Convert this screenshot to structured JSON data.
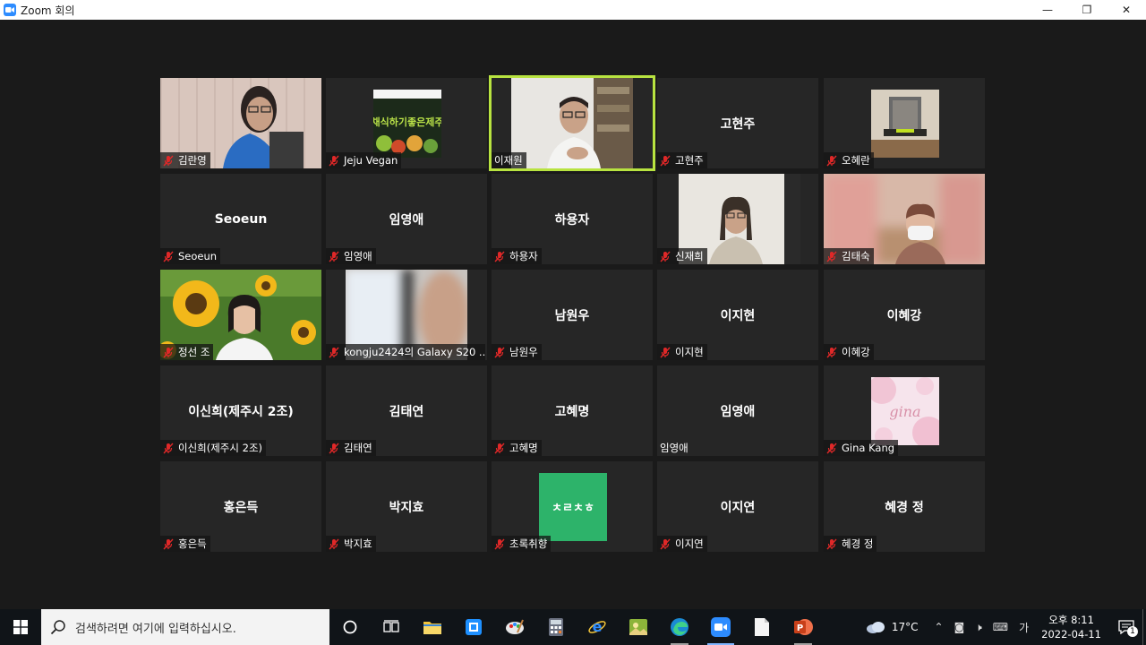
{
  "window": {
    "title": "Zoom 회의",
    "controls": {
      "minimize": "—",
      "maximize": "❐",
      "close": "✕"
    }
  },
  "tiles": [
    {
      "id": "kim-ranyoung",
      "label": "김란영",
      "center_name": "",
      "muted": true,
      "video": true
    },
    {
      "id": "jeju-vegan",
      "label": "Jeju Vegan",
      "center_name": "",
      "muted": true,
      "video": true,
      "video_text": "채식하기좋은제주"
    },
    {
      "id": "lee-jaewon",
      "label": "이재원",
      "center_name": "",
      "muted": false,
      "video": true,
      "active_speaker": true
    },
    {
      "id": "go-hyunjoo",
      "label": "고현주",
      "center_name": "고현주",
      "muted": true,
      "video": false
    },
    {
      "id": "oh-hyeran",
      "label": "오혜란",
      "center_name": "",
      "muted": true,
      "video": true
    },
    {
      "id": "seoeun",
      "label": "Seoeun",
      "center_name": "Seoeun",
      "muted": true,
      "video": false
    },
    {
      "id": "lim-youngae-1",
      "label": "임영애",
      "center_name": "임영애",
      "muted": true,
      "video": false
    },
    {
      "id": "ha-yongja",
      "label": "하용자",
      "center_name": "하용자",
      "muted": true,
      "video": false
    },
    {
      "id": "shin-jaehee",
      "label": "신재희",
      "center_name": "",
      "muted": true,
      "video": true
    },
    {
      "id": "kim-taesook",
      "label": "김태숙",
      "center_name": "",
      "muted": true,
      "video": true
    },
    {
      "id": "jo-jungsun",
      "label": "정선 조",
      "center_name": "",
      "muted": true,
      "video": true
    },
    {
      "id": "kongju2424",
      "label": "kongju2424의 Galaxy S20 ...",
      "center_name": "",
      "muted": true,
      "video": true
    },
    {
      "id": "nam-wonwoo",
      "label": "남원우",
      "center_name": "남원우",
      "muted": true,
      "video": false
    },
    {
      "id": "lee-jihyun",
      "label": "이지현",
      "center_name": "이지현",
      "muted": true,
      "video": false
    },
    {
      "id": "lee-hyekang",
      "label": "이혜강",
      "center_name": "이혜강",
      "muted": true,
      "video": false
    },
    {
      "id": "lee-shinhee",
      "label": "이신희(제주시 2조)",
      "center_name": "이신희(제주시 2조)",
      "muted": true,
      "video": false
    },
    {
      "id": "kim-taeyeon",
      "label": "김태연",
      "center_name": "김태연",
      "muted": true,
      "video": false
    },
    {
      "id": "go-hyemyung",
      "label": "고혜명",
      "center_name": "고혜명",
      "muted": true,
      "video": false
    },
    {
      "id": "lim-youngae-2",
      "label": "임영애",
      "center_name": "임영애",
      "muted": false,
      "video": false
    },
    {
      "id": "gina-kang",
      "label": "Gina Kang",
      "center_name": "",
      "muted": true,
      "video": true,
      "video_text": "gina"
    },
    {
      "id": "hong-eundeuk",
      "label": "홍은득",
      "center_name": "홍은득",
      "muted": true,
      "video": false
    },
    {
      "id": "park-jihyo",
      "label": "박지효",
      "center_name": "박지효",
      "muted": true,
      "video": false
    },
    {
      "id": "chorok-chwihyang",
      "label": "초록취향",
      "center_name": "",
      "muted": true,
      "video": true,
      "video_text": "ㅊㄹㅊㅎ"
    },
    {
      "id": "lee-jiyeon",
      "label": "이지연",
      "center_name": "이지연",
      "muted": true,
      "video": false
    },
    {
      "id": "hyekyung-jung",
      "label": "혜경 정",
      "center_name": "혜경 정",
      "muted": true,
      "video": false
    }
  ],
  "taskbar": {
    "search_placeholder": "검색하려면 여기에 입력하십시오.",
    "weather": "17°C",
    "ime": "가",
    "time": "오후 8:11",
    "date": "2022-04-11",
    "notification_count": "1"
  },
  "colors": {
    "accent_active_speaker": "#b8e340",
    "mic_off": "#e02828",
    "zoom_blue": "#2d8cff",
    "chorok_green": "#2db36a"
  }
}
